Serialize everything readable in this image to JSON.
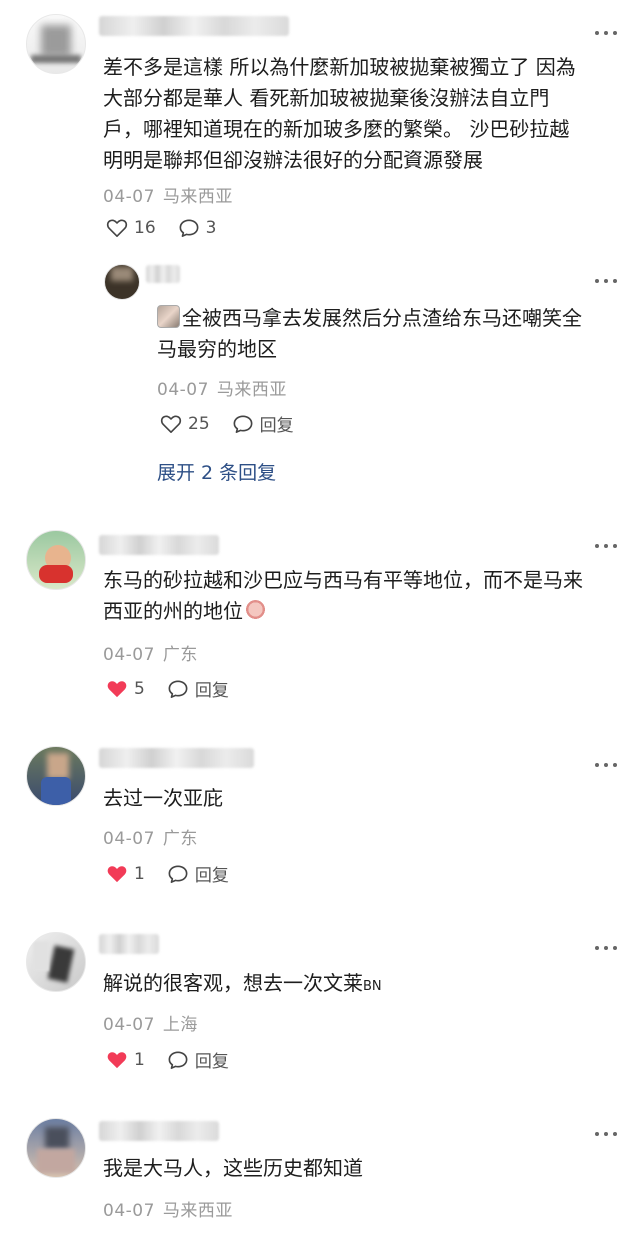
{
  "comments": [
    {
      "text": "差不多是這樣 所以為什麼新加玻被拋棄被獨立了 因為大部分都是華人 看死新加玻被拋棄後沒辦法自立門戶，哪裡知道現在的新加玻多麼的繁榮。 沙巴砂拉越明明是聯邦但卻沒辦法很好的分配資源發展",
      "lines": [
        "差不多是這樣 所以為什麼新加玻被拋棄被獨立了 因為",
        "大部分都是華人 看死新加玻被拋棄後沒辦法自立門",
        "戶，哪裡知道現在的新加玻多麼的繁榮。 沙巴砂拉越",
        "明明是聯邦但卻沒辦法很好的分配資源發展"
      ],
      "date": "04-07",
      "location": "马来西亚",
      "likes": "16",
      "replies": "3",
      "reply": {
        "text_line1": "全被西马拿去发展然后分点渣给东马还嘲笑全",
        "text_line2": "马最穷的地区",
        "date": "04-07",
        "location": "马来西亚",
        "likes": "25",
        "reply_label": "回复"
      },
      "expand_label": "展开 2 条回复"
    },
    {
      "text_line1": "东马的砂拉越和沙巴应与西马有平等地位，而不是马来",
      "text_line2": "西亚的州的地位",
      "date": "04-07",
      "location": "广东",
      "likes": "5",
      "reply_label": "回复"
    },
    {
      "text": "去过一次亚庇",
      "date": "04-07",
      "location": "广东",
      "likes": "1",
      "reply_label": "回复"
    },
    {
      "text": "解说的很客观，想去一次文莱",
      "suffix": "BN",
      "date": "04-07",
      "location": "上海",
      "likes": "1",
      "reply_label": "回复"
    },
    {
      "text": "我是大马人，这些历史都知道",
      "date": "04-07",
      "location": "马来西亚"
    }
  ],
  "colors": {
    "liked": "#f23b57",
    "link": "#2d4f86",
    "meta": "#9a9a9a"
  }
}
